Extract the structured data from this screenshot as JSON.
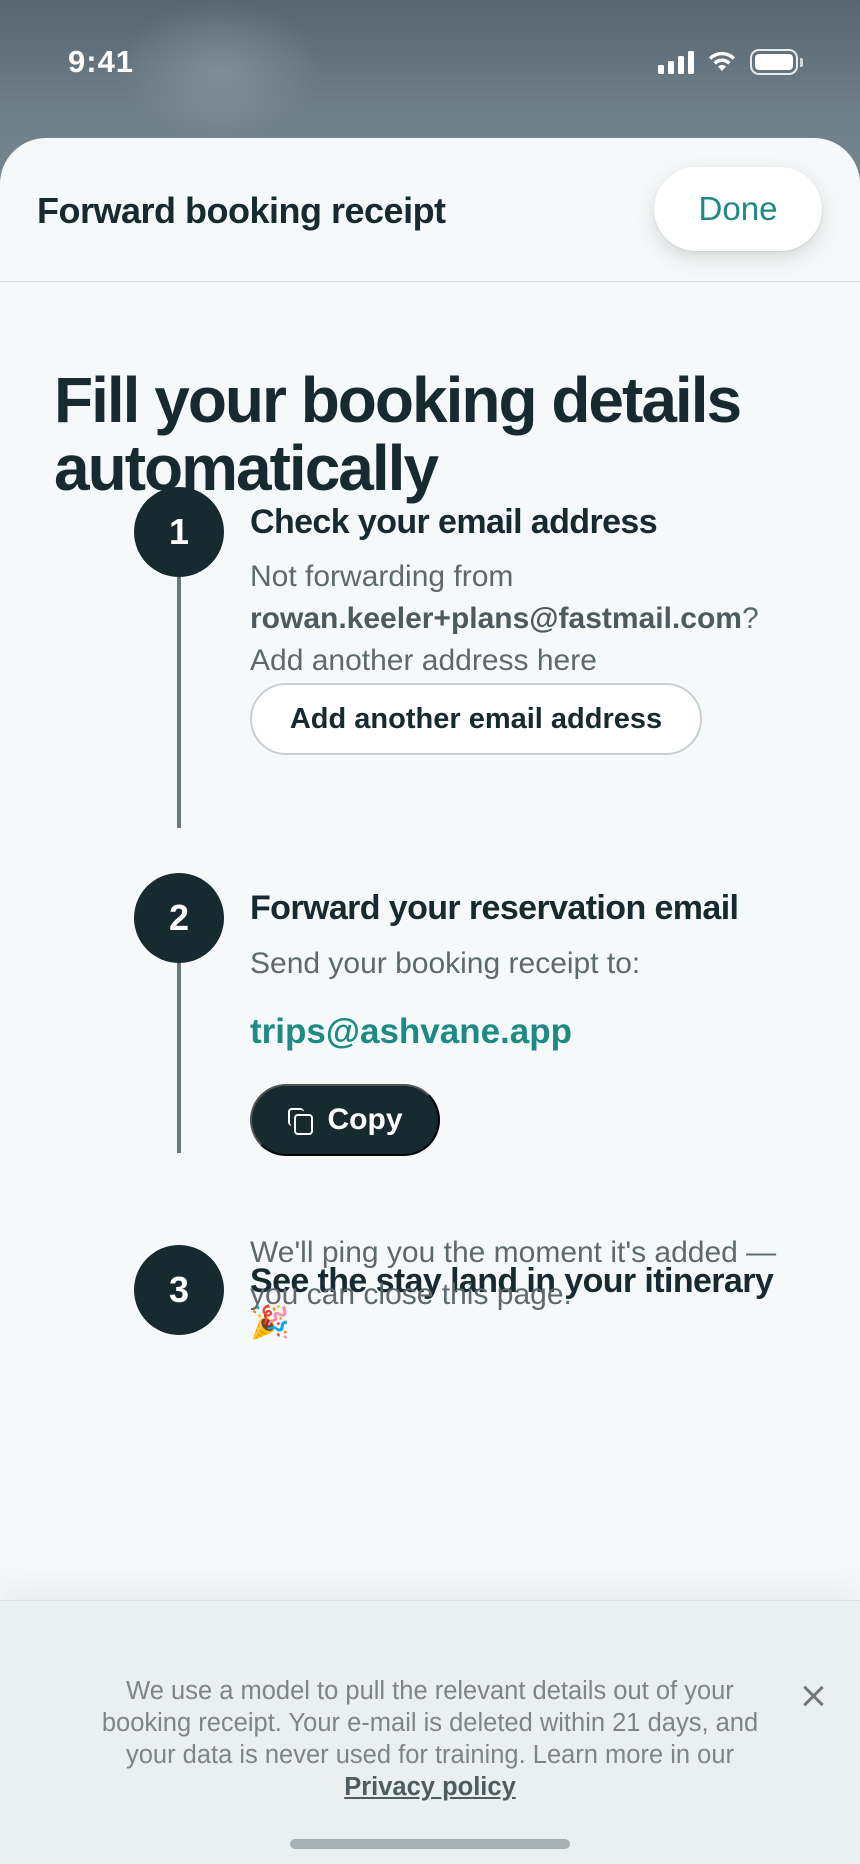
{
  "status_bar": {
    "time": "9:41"
  },
  "header": {
    "title": "Forward booking receipt",
    "done_label": "Done"
  },
  "headline": "Fill your booking details automatically",
  "steps": [
    {
      "number": "1",
      "title": "Check your email address",
      "text_intro": "Not forwarding from",
      "email": "rowan.keeler+plans@fastmail.com",
      "text_suffix": "?",
      "text_outro": "Add another address here",
      "button_label": "Add another email address"
    },
    {
      "number": "2",
      "title": "Forward your reservation email",
      "text": "Send your booking receipt to:",
      "forward_address": "trips@ashvane.app",
      "button_label": "Copy"
    },
    {
      "number": "3",
      "title": "See the stay land in your itinerary",
      "emoji": "🎉",
      "text": "We'll ping you the moment it's added — you can close this page."
    }
  ],
  "footer": {
    "text": "We use a model to pull the relevant details out of your booking receipt. Your e-mail is deleted within 21 days, and your data is never used for training. Learn more in our",
    "link_label": "Privacy policy"
  },
  "colors": {
    "accent": "#1d8a84",
    "dark": "#172a2f",
    "sheet_bg": "#f6f9f9"
  }
}
